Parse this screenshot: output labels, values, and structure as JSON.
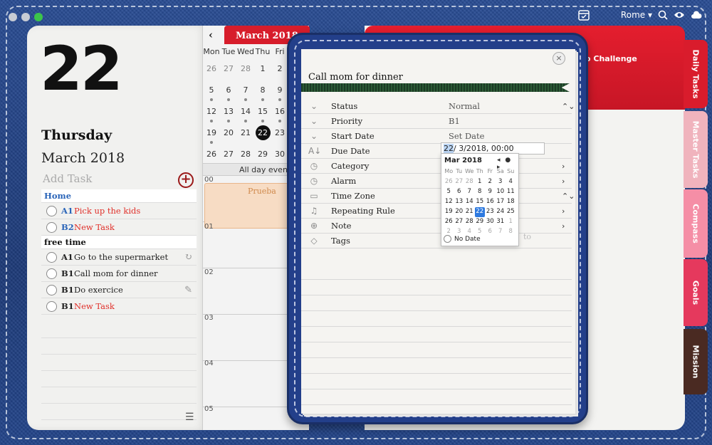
{
  "topbar": {
    "location": "Rome",
    "location_caret": "▾"
  },
  "left": {
    "day_number": "22",
    "weekday": "Thursday",
    "month_year": "March 2018",
    "add_task_placeholder": "Add Task",
    "add_icon": "+",
    "groups": [
      {
        "name": "Home",
        "tasks": [
          {
            "prio": "A1",
            "name": "Pick up the kids"
          },
          {
            "prio": "B2",
            "name": "New Task"
          }
        ]
      },
      {
        "name": "free time",
        "tasks": [
          {
            "prio": "A1",
            "name": "Go to the supermarket"
          },
          {
            "prio": "B1",
            "name": "Call mom for dinner"
          },
          {
            "prio": "B1",
            "name": "Do exercice"
          },
          {
            "prio": "B1",
            "name": "New Task"
          }
        ]
      }
    ]
  },
  "calendar": {
    "title": "March 2018",
    "prev": "‹",
    "dow": [
      "Mon",
      "Tue",
      "Wed",
      "Thu",
      "Fri"
    ],
    "weeks": [
      [
        "26",
        "27",
        "28",
        "1",
        "2"
      ],
      [
        "5",
        "6",
        "7",
        "8",
        "9"
      ],
      [
        "12",
        "13",
        "14",
        "15",
        "16"
      ],
      [
        "19",
        "20",
        "21",
        "22",
        "23"
      ],
      [
        "26",
        "27",
        "28",
        "29",
        "30"
      ]
    ],
    "all_day": "All day events",
    "event": "Prueba",
    "hours": [
      "00",
      "01",
      "02",
      "03",
      "04",
      "05"
    ]
  },
  "right_page": {
    "challenge": "o Challenge"
  },
  "tabs": [
    "Daily Tasks",
    "Master Tasks",
    "Compass",
    "Goals",
    "Mission"
  ],
  "popover": {
    "close": "×",
    "title": "Call mom for dinner",
    "fields": [
      {
        "icon": "chevron-icon",
        "glyph": "⌄",
        "label": "Status",
        "value": "Normal",
        "arrow": "⌃⌄"
      },
      {
        "icon": "chevron-icon",
        "glyph": "⌄",
        "label": "Priority",
        "value": "B1",
        "arrow": ""
      },
      {
        "icon": "chevron-icon",
        "glyph": "⌄",
        "label": "Start Date",
        "value": "Set Date",
        "arrow": ""
      },
      {
        "icon": "sort-icon",
        "glyph": "A↓",
        "label": "Due Date",
        "value": "",
        "arrow": ""
      },
      {
        "icon": "clock-icon",
        "glyph": "◷",
        "label": "Category",
        "value": "",
        "arrow": "›"
      },
      {
        "icon": "clock-icon",
        "glyph": "◷",
        "label": "Alarm",
        "value": "",
        "arrow": "›"
      },
      {
        "icon": "folder-icon",
        "glyph": "▭",
        "label": "Time Zone",
        "value": "",
        "arrow": "⌃⌄"
      },
      {
        "icon": "bell-icon",
        "glyph": "♫",
        "label": "Repeating Rule",
        "value": "",
        "arrow": "›"
      },
      {
        "icon": "globe-icon",
        "glyph": "⊕",
        "label": "Note",
        "value": "",
        "arrow": "›"
      },
      {
        "icon": "tag-icon",
        "glyph": "◇",
        "label": "Tags",
        "value": "",
        "arrow": ""
      }
    ],
    "to_text": "to"
  },
  "datepicker": {
    "input_day": "22",
    "input_rest": "/  3/2018, 00:00",
    "month": "Mar 2018",
    "nav": "◂ ● ▸",
    "dow": [
      "Mo",
      "Tu",
      "We",
      "Th",
      "Fr",
      "Sa",
      "Su"
    ],
    "weeks": [
      [
        "26",
        "27",
        "28",
        "1",
        "2",
        "3",
        "4"
      ],
      [
        "5",
        "6",
        "7",
        "8",
        "9",
        "10",
        "11"
      ],
      [
        "12",
        "13",
        "14",
        "15",
        "16",
        "17",
        "18"
      ],
      [
        "19",
        "20",
        "21",
        "22",
        "23",
        "24",
        "25"
      ],
      [
        "26",
        "27",
        "28",
        "29",
        "30",
        "31",
        "1"
      ],
      [
        "2",
        "3",
        "4",
        "5",
        "6",
        "7",
        "8"
      ]
    ],
    "no_date": "No Date"
  }
}
